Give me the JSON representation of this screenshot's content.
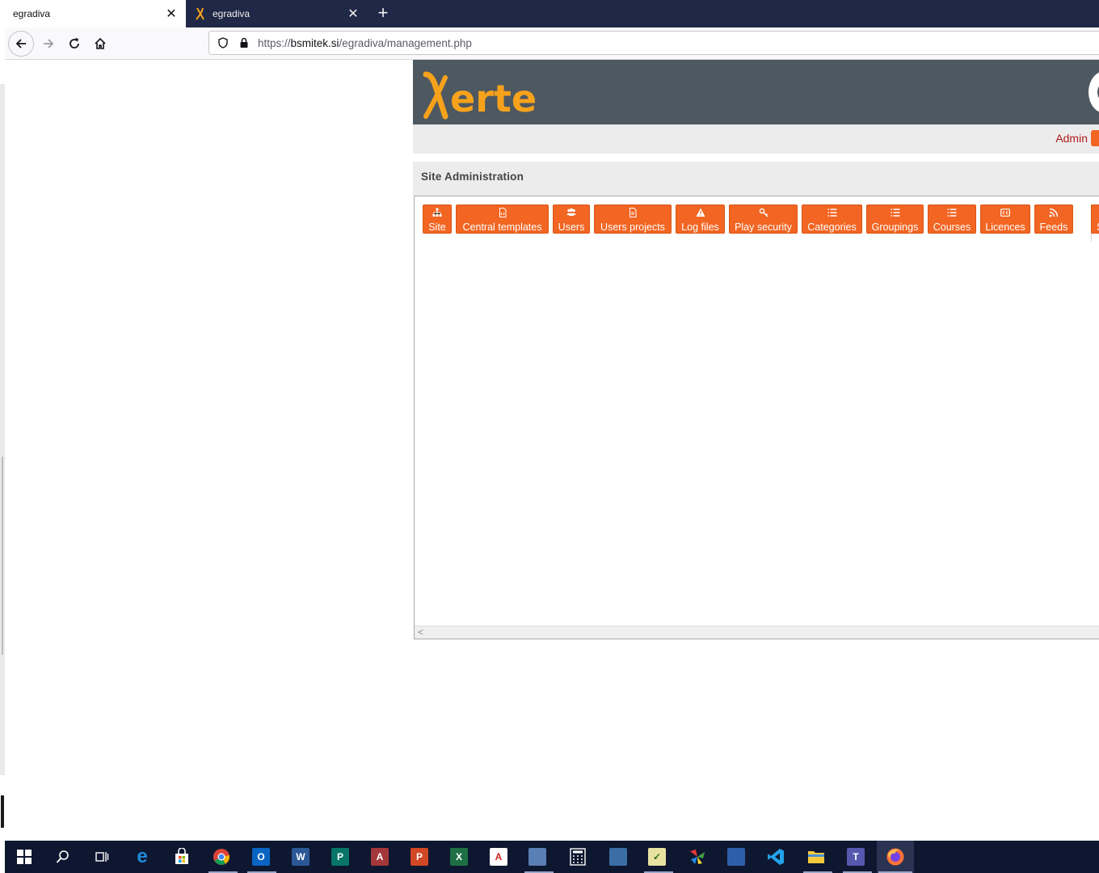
{
  "browser": {
    "tabs": [
      {
        "title": "egradiva",
        "close": "✕",
        "active": true
      },
      {
        "title": "egradiva",
        "close": "✕",
        "active": false
      }
    ],
    "new_tab": "+",
    "url": {
      "scheme": "https://",
      "domain": "bsmitek.si",
      "path": "/egradiva/management.php"
    },
    "nav": {
      "back": "back-icon",
      "forward": "forward-icon",
      "reload": "reload-icon",
      "home": "home-icon"
    }
  },
  "app": {
    "logo_text": "erte",
    "user_link": "Admin",
    "panel_title": "Site Administration",
    "toolbar": [
      {
        "label": "Site",
        "icon": "sitemap-icon"
      },
      {
        "label": "Central templates",
        "icon": "file-code-icon"
      },
      {
        "label": "Users",
        "icon": "users-icon"
      },
      {
        "label": "Users projects",
        "icon": "file-icon"
      },
      {
        "label": "Log files",
        "icon": "warning-icon"
      },
      {
        "label": "Play security",
        "icon": "key-icon"
      },
      {
        "label": "Categories",
        "icon": "list-icon"
      },
      {
        "label": "Groupings",
        "icon": "list-icon"
      },
      {
        "label": "Courses",
        "icon": "list-icon"
      },
      {
        "label": "Licences",
        "icon": "cc-icon"
      },
      {
        "label": "Feeds",
        "icon": "rss-icon"
      },
      {
        "label": "S",
        "icon": "save-icon"
      }
    ],
    "scroll_arrow": "<"
  },
  "taskbar": {
    "items": [
      "start-icon",
      "search-icon",
      "task-view-icon",
      "edge-icon",
      "store-icon",
      "chrome-icon",
      "outlook-icon",
      "word-icon",
      "publisher-icon",
      "access-icon",
      "powerpoint-icon",
      "excel-icon",
      "acrobat-icon",
      "image-viewer-icon",
      "calculator-icon",
      "network-icon",
      "project-icon",
      "app-icon",
      "remote-desktop-icon",
      "vscode-icon",
      "file-explorer-icon",
      "teams-icon",
      "firefox-icon"
    ]
  },
  "colors": {
    "accent": "#f26522",
    "header": "#4e5860",
    "logo": "#f7a21b",
    "tabstrip": "#1f2846",
    "taskbar": "#0e1730"
  }
}
